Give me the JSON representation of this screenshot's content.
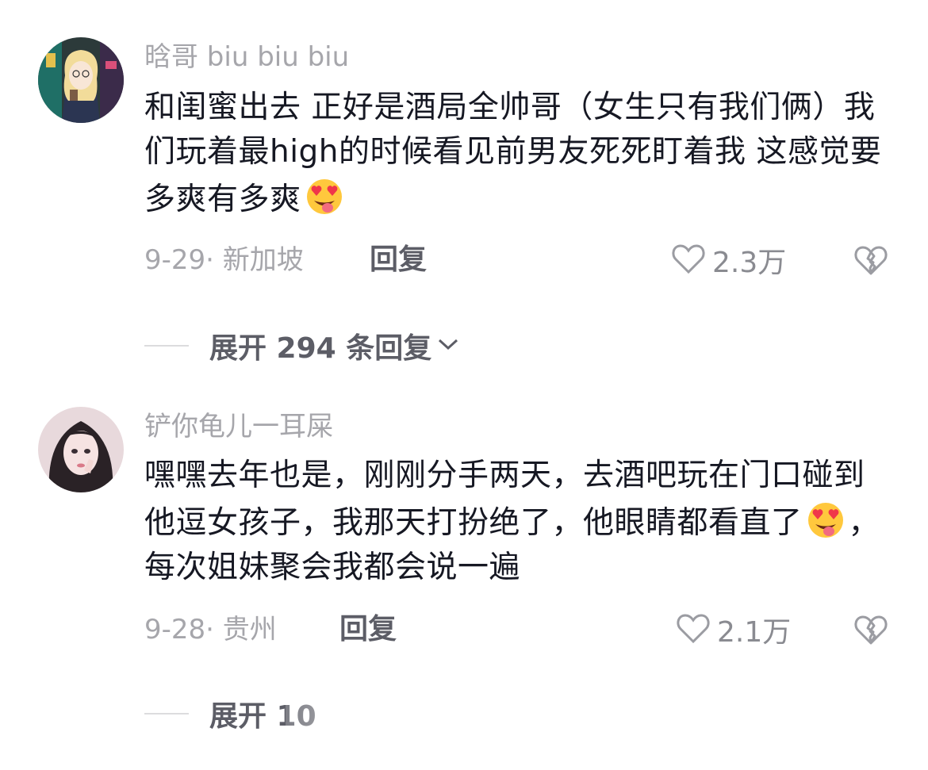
{
  "comments": [
    {
      "username": "晗哥 biu biu biu",
      "text_before_emoji": "和闺蜜出去 正好是酒局全帅哥（女生只有我们俩）我们玩着最high的时候看见前男友死死盯着我 这感觉要多爽有多爽",
      "text_after_emoji": "",
      "date_location": "9-29· 新加坡",
      "reply_label": "回复",
      "likes": "2.3万",
      "expand_label": "展开 294 条回复"
    },
    {
      "username": "铲你龟儿一耳屎",
      "text_before_emoji": "嘿嘿去年也是，刚刚分手两天，去酒吧玩在门口碰到他逗女孩子，我那天打扮绝了，他眼睛都看直了",
      "text_after_emoji": "，每次姐妹聚会我都会说一遍",
      "date_location": "9-28· 贵州",
      "reply_label": "回复",
      "likes": "2.1万",
      "expand_label": "展开 10"
    }
  ],
  "icons": {
    "emoji": "heart-eyes-tongue-emoji",
    "like": "heart-outline-icon",
    "dislike": "broken-heart-icon",
    "expand": "chevron-down-icon"
  },
  "colors": {
    "text": "#161823",
    "secondary": "#a6a6ab",
    "action": "#5c5d66",
    "emoji_face": "#ffc83d",
    "emoji_heart": "#f0364a"
  }
}
